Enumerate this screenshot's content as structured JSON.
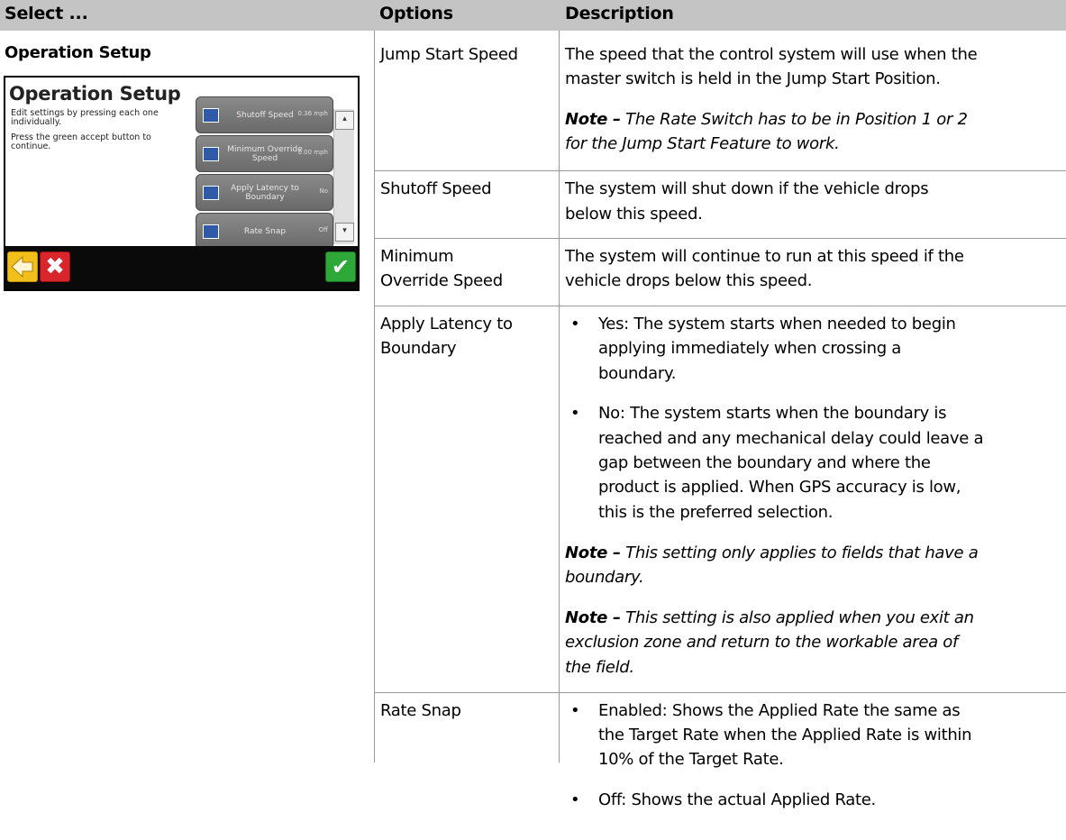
{
  "header": {
    "col1": "Select ...",
    "col2": "Options",
    "col3": "Description"
  },
  "section": {
    "title": "Operation Setup"
  },
  "device": {
    "title": "Operation Setup",
    "instructions": [
      "Edit settings by pressing each one",
      "individually.",
      "Press the green accept button to",
      "continue."
    ],
    "buttons": [
      {
        "label": "Shutoff Speed",
        "value": "0.36 mph"
      },
      {
        "label": "Minimum Override Speed",
        "value": "0.00 mph"
      },
      {
        "label": "Apply Latency to Boundary",
        "value": "No"
      },
      {
        "label": "Rate Snap",
        "value": "Off"
      }
    ],
    "scroll_up": "▴",
    "scroll_down": "▾",
    "back_icon": "back-arrow-icon",
    "cancel_icon": "✖",
    "accept_icon": "✔"
  },
  "rows": {
    "jump": {
      "option": "Jump Start Speed",
      "desc": [
        "The speed that the control system will use when the",
        "master switch is held in the Jump Start Position."
      ],
      "note_label": "Note –",
      "note": [
        "The Rate Switch has to be in Position 1 or 2",
        "for the Jump Start Feature to work."
      ]
    },
    "shutoff": {
      "option": "Shutoff Speed",
      "desc": [
        "The system will shut down if the vehicle drops",
        "below this speed."
      ]
    },
    "minimum": {
      "option": [
        "Minimum",
        "Override Speed"
      ],
      "desc": [
        "The system will continue to run at this speed if the",
        "vehicle drops below this speed."
      ]
    },
    "latency": {
      "option": [
        "Apply Latency to",
        "Boundary"
      ],
      "bullet": "•",
      "yes": [
        "Yes: The system starts when needed to begin",
        "applying immediately when crossing a",
        "boundary."
      ],
      "no": [
        "No: The system starts when the boundary is",
        "reached and any mechanical delay could leave a",
        "gap between the boundary and where the",
        "product is applied. When GPS accuracy is low,",
        "this is the preferred selection."
      ],
      "note1_label": "Note –",
      "note1": [
        "This setting only applies to fields that have a",
        "boundary."
      ],
      "note2_label": "Note –",
      "note2": [
        "This setting is also applied when you exit an",
        "exclusion zone and return to the workable area of",
        "the field."
      ]
    },
    "ratesnap": {
      "option": "Rate Snap",
      "bullet": "•",
      "enabled": [
        "Enabled: Shows the Applied Rate the same as",
        "the Target Rate when the Applied Rate is within",
        "10% of the Target Rate."
      ],
      "off": "Off: Shows the actual Applied Rate."
    }
  }
}
